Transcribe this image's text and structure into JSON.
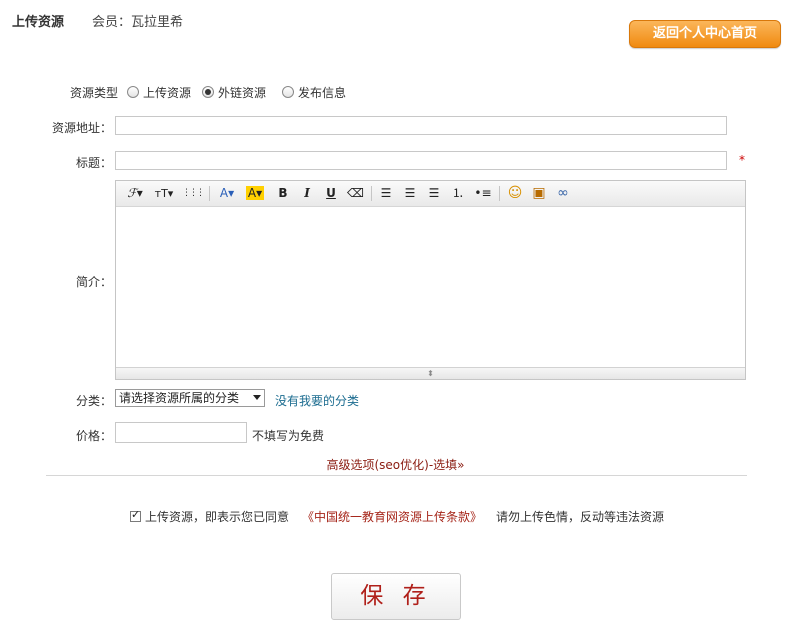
{
  "header": {
    "title": "上传资源",
    "member": "会员：瓦拉里希",
    "home_button": "返回个人中心首页"
  },
  "form": {
    "type_label": "资源类型",
    "type_options": [
      "上传资源",
      "外链资源",
      "发布信息"
    ],
    "type_selected": "外链资源",
    "url_label": "资源地址：",
    "url_value": "",
    "title_label": "标题：",
    "title_value": "",
    "required_mark": "*",
    "intro_label": "简介：",
    "category_label": "分类：",
    "category_selected": "请选择资源所属的分类",
    "category_missing_link": "没有我要的分类",
    "price_label": "价格：",
    "price_value": "",
    "price_hint": "不填写为免费",
    "advanced_link": "高级选项(seo优化)-选填»"
  },
  "editor": {
    "toolbar": [
      {
        "icon": "font-family-icon",
        "glyph": "ℱ▾"
      },
      {
        "icon": "font-size-icon",
        "glyph": "тT▾"
      },
      {
        "icon": "line-height-icon",
        "glyph": "⋮⋮⋮"
      },
      {
        "icon": "font-color-icon",
        "glyph": "A▾"
      },
      {
        "icon": "highlight-color-icon",
        "glyph": "A▾"
      },
      {
        "icon": "bold-icon",
        "glyph": "B"
      },
      {
        "icon": "italic-icon",
        "glyph": "I"
      },
      {
        "icon": "underline-icon",
        "glyph": "U"
      },
      {
        "icon": "clear-format-icon",
        "glyph": "⌫"
      },
      {
        "icon": "align-left-icon",
        "glyph": "☰"
      },
      {
        "icon": "align-center-icon",
        "glyph": "☰"
      },
      {
        "icon": "align-right-icon",
        "glyph": "☰"
      },
      {
        "icon": "ordered-list-icon",
        "glyph": "⒈"
      },
      {
        "icon": "unordered-list-icon",
        "glyph": "•≡"
      },
      {
        "icon": "emoticon-icon",
        "glyph": "☺"
      },
      {
        "icon": "insert-image-icon",
        "glyph": "▣"
      },
      {
        "icon": "insert-link-icon",
        "glyph": "∞"
      }
    ]
  },
  "agreement": {
    "checked": true,
    "prefix": "上传资源，即表示您已同意",
    "terms_link": "《中国统一教育网资源上传条款》",
    "suffix": "请勿上传色情，反动等违法资源"
  },
  "save_button": "保 存"
}
